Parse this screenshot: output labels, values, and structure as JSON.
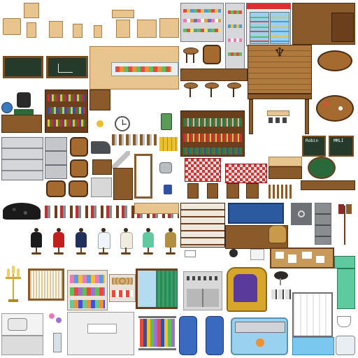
{
  "tileset": {
    "signs": {
      "menu_left": "Robin",
      "menu_right": "MMLI"
    },
    "colors": {
      "wood": "#8a5a2b",
      "wood_light": "#e8c48e",
      "wood_dark": "#6b3f1c",
      "tablecloth_red": "#d93030",
      "chalkboard": "#263a2c",
      "metal": "#b9bcc0",
      "blue_rug": "#2c5aa0",
      "gold": "#d8a62a",
      "teal": "#5fc9a0",
      "purple": "#5a3a9a"
    },
    "icons": [
      "school-desk-icon",
      "school-chair-icon",
      "chalkboard-icon",
      "wall-clock-icon",
      "bookshelf-icon",
      "barrel-icon",
      "bar-stool-icon",
      "candle-chandelier-icon",
      "round-table-icon",
      "vending-fridge-icon",
      "grocery-shelf-icon",
      "anvil-icon",
      "tool-rack-icon",
      "mannequin-icon",
      "throne-icon",
      "jail-bars-icon",
      "sewing-machine-icon",
      "loom-icon",
      "clothing-rack-icon",
      "safe-icon",
      "filing-cabinet-icon",
      "coat-stand-icon",
      "gold-candelabra-icon",
      "reception-counter-icon"
    ]
  }
}
